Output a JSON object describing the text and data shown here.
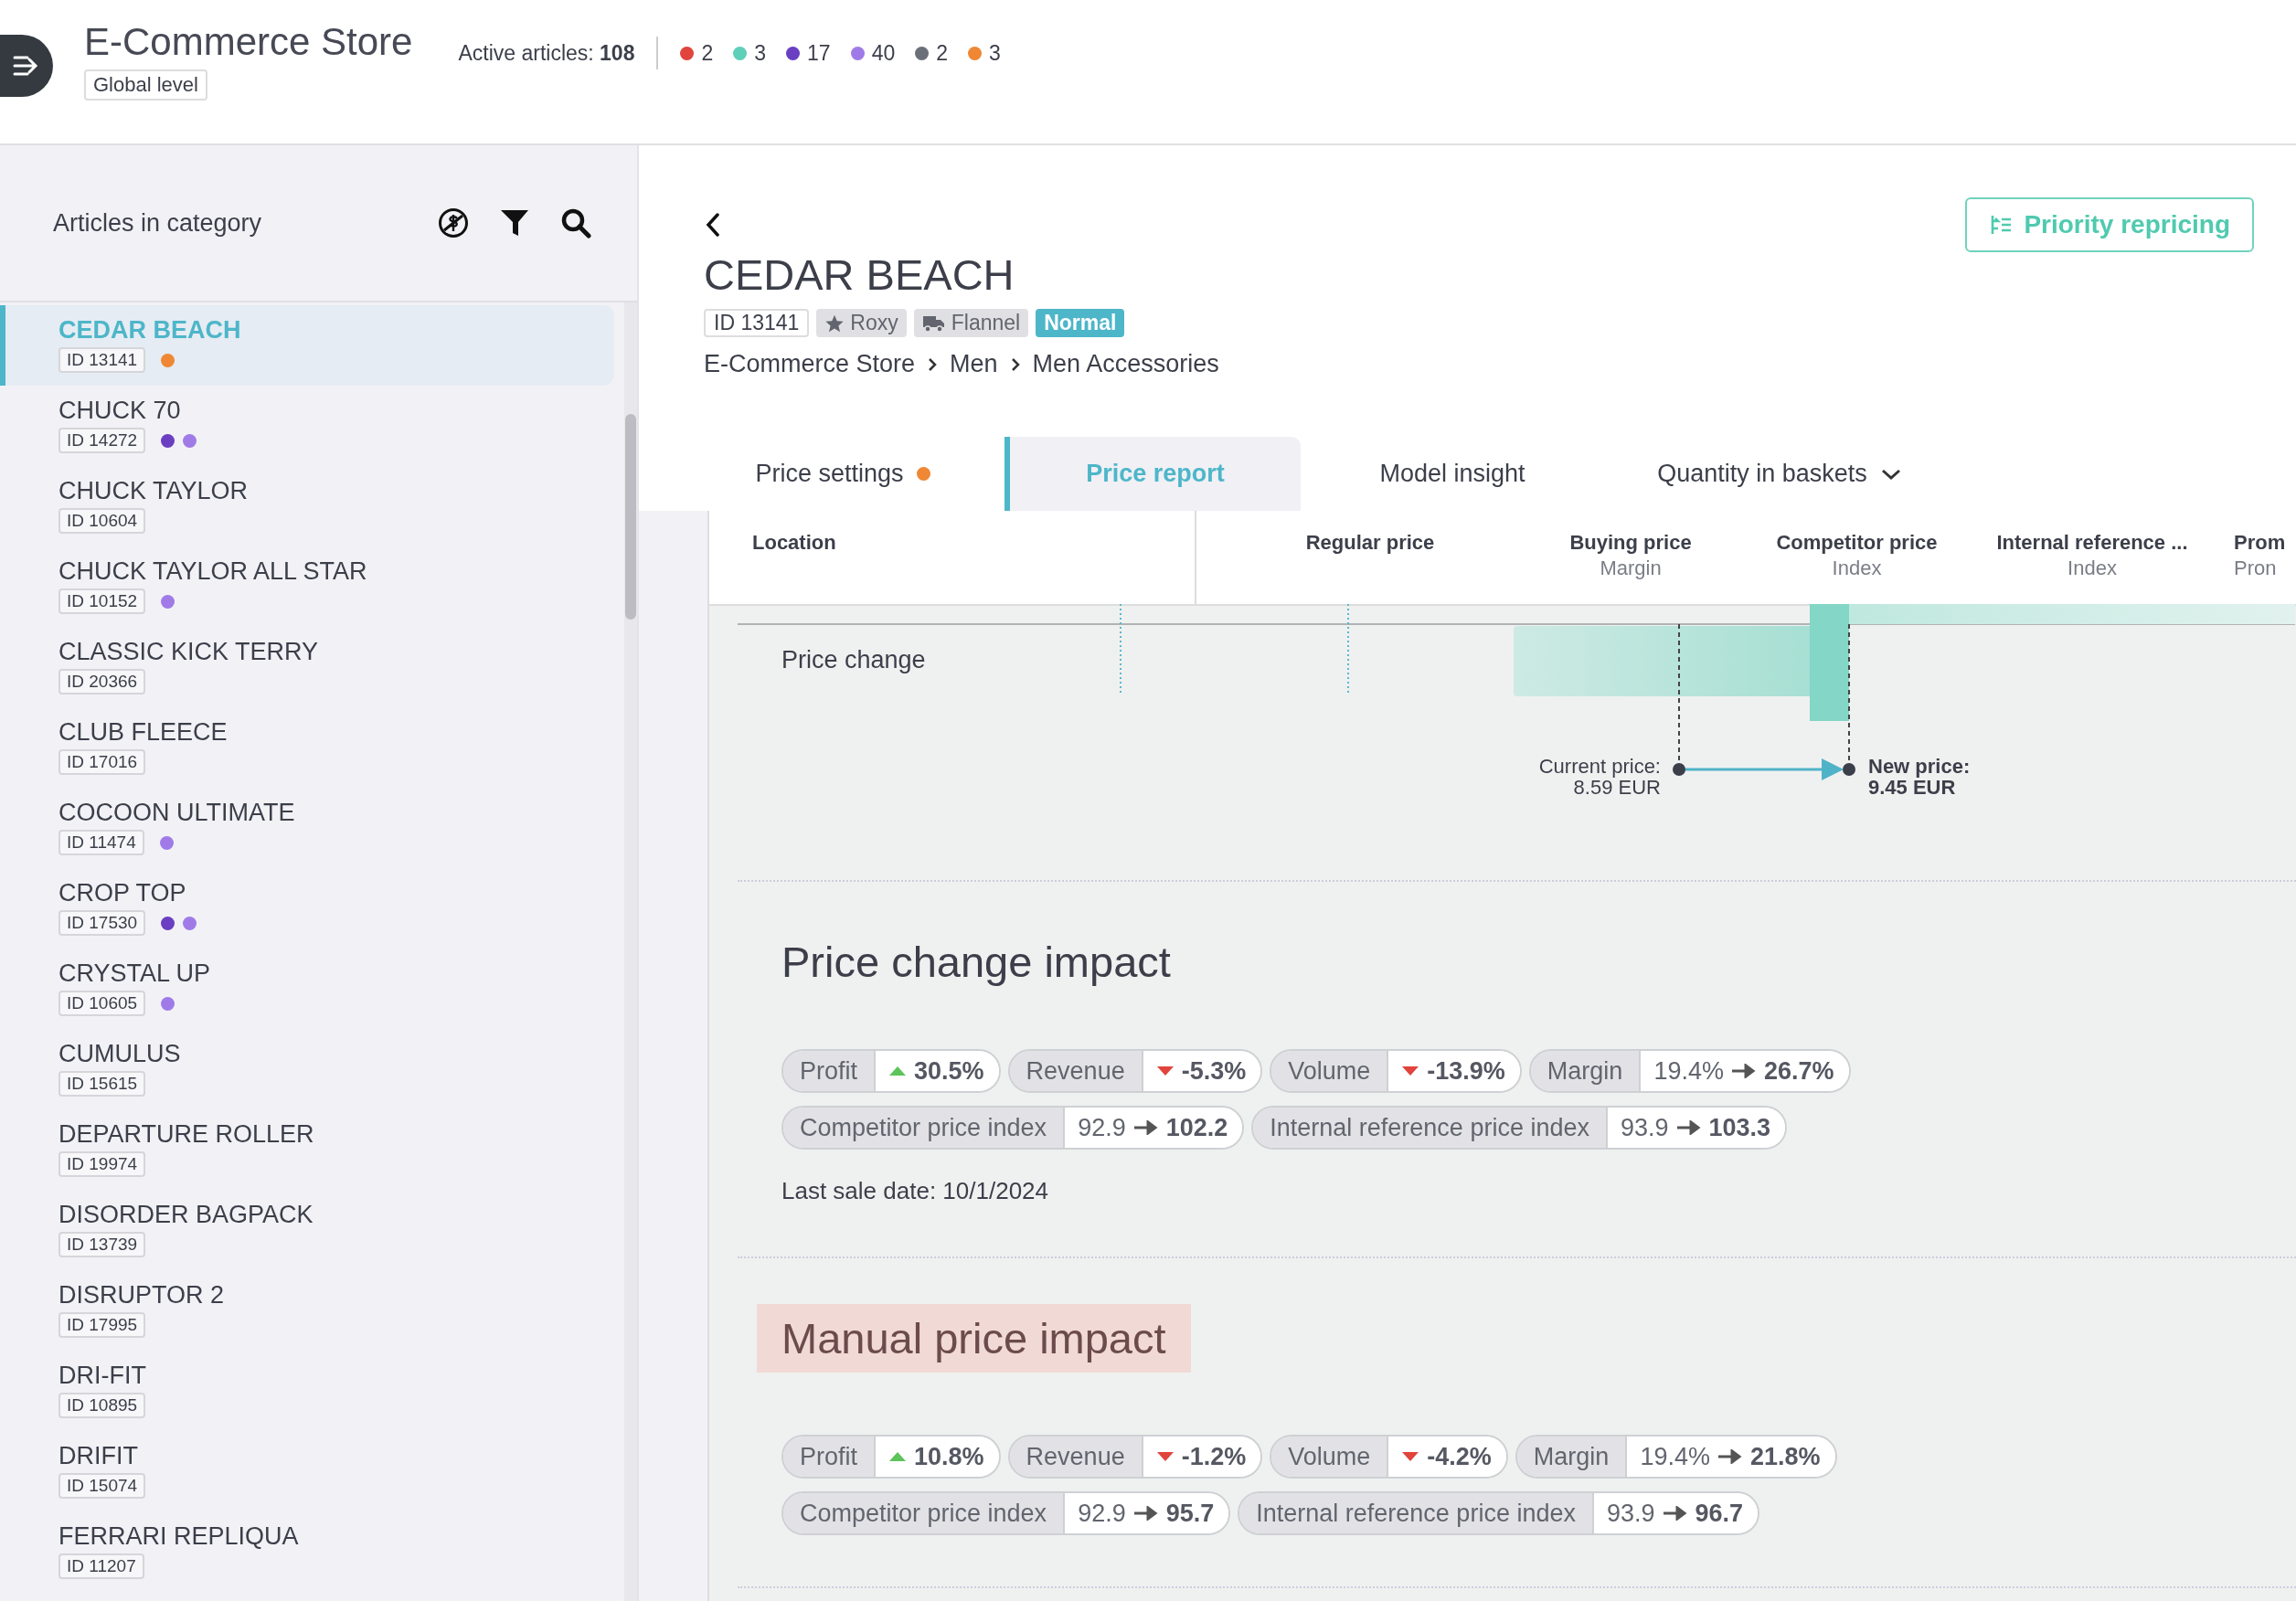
{
  "header": {
    "title": "E-Commerce Store",
    "level_badge": "Global level",
    "active_label": "Active articles:",
    "active_count": "108",
    "status_counts": [
      {
        "color": "#e0443c",
        "count": "2"
      },
      {
        "color": "#5ecfb9",
        "count": "3"
      },
      {
        "color": "#6a3fc1",
        "count": "17"
      },
      {
        "color": "#a07be8",
        "count": "40"
      },
      {
        "color": "#6b7078",
        "count": "2"
      },
      {
        "color": "#ef8734",
        "count": "3"
      }
    ]
  },
  "sidebar": {
    "title": "Articles in category",
    "items": [
      {
        "name": "CEDAR BEACH",
        "id": "ID 13141",
        "selected": true,
        "dots": [
          {
            "color": "#ef8734"
          }
        ]
      },
      {
        "name": "CHUCK 70",
        "id": "ID 14272",
        "selected": false,
        "dots": [
          {
            "color": "#6a3fc1"
          },
          {
            "color": "#a07be8"
          }
        ]
      },
      {
        "name": "CHUCK TAYLOR",
        "id": "ID 10604",
        "selected": false
      },
      {
        "name": "CHUCK TAYLOR ALL STAR",
        "id": "ID 10152",
        "selected": false,
        "dots": [
          {
            "color": "#a07be8"
          }
        ]
      },
      {
        "name": "CLASSIC KICK TERRY",
        "id": "ID 20366",
        "selected": false
      },
      {
        "name": "CLUB FLEECE",
        "id": "ID 17016",
        "selected": false
      },
      {
        "name": "COCOON ULTIMATE",
        "id": "ID 11474",
        "selected": false,
        "dots": [
          {
            "color": "#a07be8"
          }
        ]
      },
      {
        "name": "CROP TOP",
        "id": "ID 17530",
        "selected": false,
        "dots": [
          {
            "color": "#6a3fc1"
          },
          {
            "color": "#a07be8"
          }
        ]
      },
      {
        "name": "CRYSTAL UP",
        "id": "ID 10605",
        "selected": false,
        "dots": [
          {
            "color": "#a07be8"
          }
        ]
      },
      {
        "name": "CUMULUS",
        "id": "ID 15615",
        "selected": false
      },
      {
        "name": "DEPARTURE ROLLER",
        "id": "ID 19974",
        "selected": false
      },
      {
        "name": "DISORDER BAGPACK",
        "id": "ID 13739",
        "selected": false
      },
      {
        "name": "DISRUPTOR 2",
        "id": "ID 17995",
        "selected": false
      },
      {
        "name": "DRI-FIT",
        "id": "ID 10895",
        "selected": false
      },
      {
        "name": "DRIFIT",
        "id": "ID 15074",
        "selected": false
      },
      {
        "name": "FERRARI REPLIQUA",
        "id": "ID 11207",
        "selected": false
      }
    ]
  },
  "article": {
    "title": "CEDAR BEACH",
    "action_button": "Priority repricing",
    "tags": [
      {
        "kind": "id",
        "label": "ID 13141"
      },
      {
        "kind": "star",
        "label": "Roxy"
      },
      {
        "kind": "truck",
        "label": "Flannel"
      },
      {
        "kind": "status",
        "label": "Normal"
      }
    ],
    "breadcrumb": [
      "E-Commerce Store",
      "Men",
      "Men Accessories"
    ]
  },
  "tabs": [
    {
      "label": "Price settings",
      "selected": false,
      "status_dot": {
        "color": "#ef8734"
      },
      "dropdown": false
    },
    {
      "label": "Price report",
      "selected": true,
      "dropdown": false
    },
    {
      "label": "Model insight",
      "selected": false,
      "dropdown": false
    },
    {
      "label": "Quantity in baskets",
      "selected": false,
      "dropdown": true
    }
  ],
  "table": {
    "columns": [
      {
        "title": "Location"
      },
      {
        "title": "Regular price"
      },
      {
        "title": "Buying price",
        "subtitle": "Margin"
      },
      {
        "title": "Competitor price",
        "subtitle": "Index"
      },
      {
        "title": "Internal reference ...",
        "subtitle": "Index"
      },
      {
        "title": "Prom",
        "subtitle": "Pron"
      }
    ],
    "price_change": {
      "label": "Price change",
      "current_label": "Current price:",
      "current_value": "8.59 EUR",
      "new_label": "New price:",
      "new_value": "9.45 EUR"
    }
  },
  "impacts": [
    {
      "title": "Price change impact",
      "highlighted": false,
      "last_sale": "Last sale date: 10/1/2024",
      "metrics": [
        {
          "label": "Profit",
          "kind": "change",
          "increase": true,
          "value": "30.5%"
        },
        {
          "label": "Revenue",
          "kind": "change",
          "increase": false,
          "value": "-5.3%"
        },
        {
          "label": "Volume",
          "kind": "change",
          "increase": false,
          "value": "-13.9%"
        },
        {
          "label": "Margin",
          "kind": "transition",
          "from": "19.4%",
          "to": "26.7%"
        },
        {
          "label": "Competitor price index",
          "kind": "transition",
          "from": "92.9",
          "to": "102.2"
        },
        {
          "label": "Internal reference price index",
          "kind": "transition",
          "from": "93.9",
          "to": "103.3"
        }
      ]
    },
    {
      "title": "Manual price impact",
      "highlighted": true,
      "metrics": [
        {
          "label": "Profit",
          "kind": "change",
          "increase": true,
          "value": "10.8%"
        },
        {
          "label": "Revenue",
          "kind": "change",
          "increase": false,
          "value": "-1.2%"
        },
        {
          "label": "Volume",
          "kind": "change",
          "increase": false,
          "value": "-4.2%"
        },
        {
          "label": "Margin",
          "kind": "transition",
          "from": "19.4%",
          "to": "21.8%"
        },
        {
          "label": "Competitor price index",
          "kind": "transition",
          "from": "92.9",
          "to": "95.7"
        },
        {
          "label": "Internal reference price index",
          "kind": "transition",
          "from": "93.9",
          "to": "96.7"
        }
      ]
    }
  ]
}
